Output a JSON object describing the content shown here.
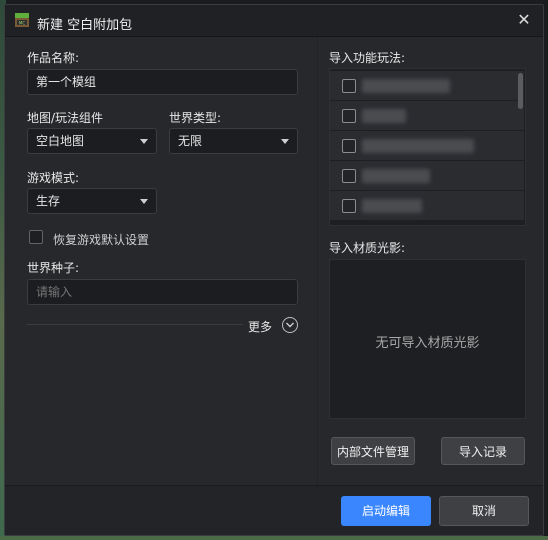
{
  "window": {
    "title": "新建 空白附加包",
    "close_glyph": "✕"
  },
  "left": {
    "name_label": "作品名称:",
    "name_value": "第一个模组",
    "map_label": "地图/玩法组件",
    "map_value": "空白地图",
    "world_type_label": "世界类型:",
    "world_type_value": "无限",
    "game_mode_label": "游戏模式:",
    "game_mode_value": "生存",
    "restore_default_label": "恢复游戏默认设置",
    "restore_default_checked": false,
    "seed_label": "世界种子:",
    "seed_placeholder": "请输入",
    "more_label": "更多"
  },
  "right": {
    "import_gameplay_label": "导入功能玩法:",
    "gameplay_items": [
      {
        "checked": false
      },
      {
        "checked": false
      },
      {
        "checked": false
      },
      {
        "checked": false
      },
      {
        "checked": false
      }
    ],
    "import_texture_label": "导入材质光影:",
    "texture_empty_text": "无可导入材质光影",
    "internal_files_button": "内部文件管理",
    "import_history_button": "导入记录"
  },
  "footer": {
    "start_button": "启动编辑",
    "cancel_button": "取消"
  },
  "colors": {
    "primary": "#3a86ff",
    "dialog_bg": "#26282b"
  }
}
